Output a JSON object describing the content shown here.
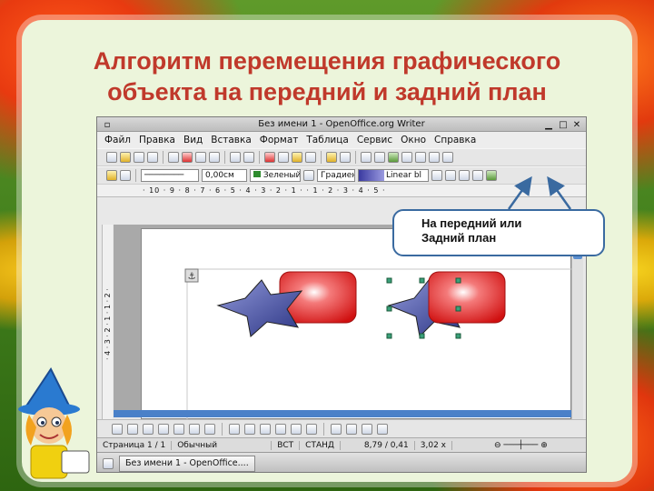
{
  "slide": {
    "title_line1": "Алгоритм перемещения графического",
    "title_line2": "объекта на передний и задний план",
    "callout_line1": "На передний или",
    "callout_line2": "Задний план"
  },
  "window": {
    "title": "Без имени 1 - OpenOffice.org Writer",
    "menu": [
      "Файл",
      "Правка",
      "Вид",
      "Вставка",
      "Формат",
      "Таблица",
      "Сервис",
      "Окно",
      "Справка"
    ],
    "line_width": "0,00см",
    "line_color": "Зеленый",
    "fill_style": "Градиен",
    "gradient": "Linear bl",
    "ruler_text": "· 10 · 9 · 8 · 7 · 6 · 5 · 4 · 3 · 2 · 1 ·   · 1 · 2 · 3 · 4 · 5 ·",
    "vruler_text": "· 4 · 3 · 2 · 1 · 1 · 2 ·"
  },
  "statusbar": {
    "page": "Страница  1 / 1",
    "style": "Обычный",
    "insert": "ВСТ",
    "mode": "СТАНД",
    "position": "8,79 / 0,41",
    "size": "3,02 x"
  },
  "taskbar": {
    "task_label": "Без имени 1 - OpenOffice...."
  },
  "colors": {
    "title": "#c0392b",
    "star": "#3d4a9a",
    "rect": "#e02020",
    "callout_border": "#3a6aa0"
  },
  "icons": [
    "new-icon",
    "open-icon",
    "save-icon",
    "cut-icon",
    "copy-icon",
    "paste-icon",
    "undo-icon",
    "redo-icon",
    "anchor-icon",
    "text-icon",
    "bring-to-front-icon",
    "send-to-back-icon"
  ]
}
